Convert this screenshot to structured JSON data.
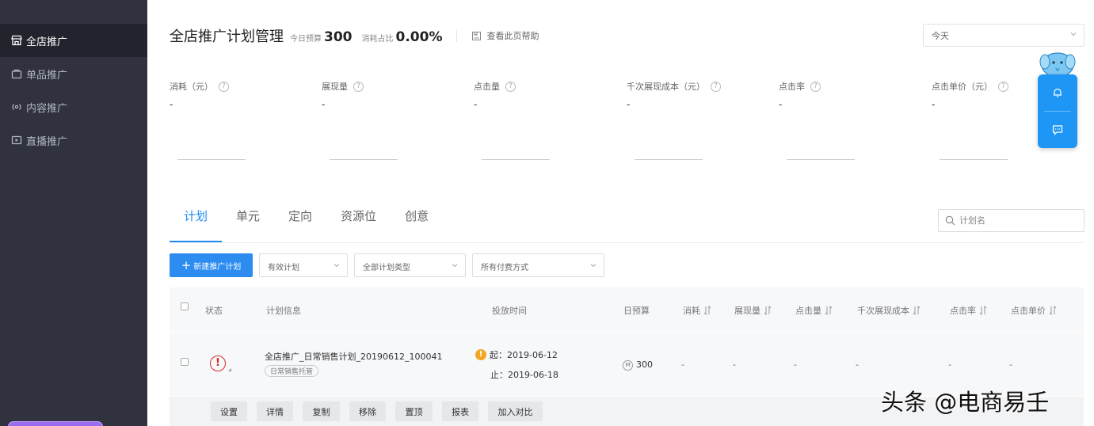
{
  "sidebar": {
    "items": [
      {
        "label": "全店推广",
        "icon": "store-icon"
      },
      {
        "label": "单品推广",
        "icon": "bag-icon"
      },
      {
        "label": "内容推广",
        "icon": "broadcast-icon"
      },
      {
        "label": "直播推广",
        "icon": "live-icon"
      }
    ]
  },
  "header": {
    "title": "全店推广计划管理",
    "budget_label": "今日预算",
    "budget_value": "300",
    "ratio_label": "消耗占比",
    "ratio_value": "0.00%",
    "help_label": "查看此页帮助"
  },
  "date_select": {
    "value": "今天"
  },
  "metrics": [
    {
      "label": "消耗（元）",
      "value": "-"
    },
    {
      "label": "展现量",
      "value": "-"
    },
    {
      "label": "点击量",
      "value": "-"
    },
    {
      "label": "千次展现成本（元）",
      "value": "-"
    },
    {
      "label": "点击率",
      "value": "-"
    },
    {
      "label": "点击单价（元）",
      "value": "-"
    }
  ],
  "tabs": [
    "计划",
    "单元",
    "定向",
    "资源位",
    "创意"
  ],
  "search": {
    "placeholder": "计划名"
  },
  "toolbar": {
    "new_label": "新建推广计划",
    "filters": [
      "有效计划",
      "全部计划类型",
      "所有付费方式"
    ]
  },
  "table": {
    "columns": {
      "status": "状态",
      "info": "计划信息",
      "time": "投放时间",
      "budget": "日预算",
      "cost": "消耗",
      "impressions": "展现量",
      "clicks": "点击量",
      "cpm": "千次展现成本",
      "ctr": "点击率",
      "cpc": "点击单价"
    },
    "rows": [
      {
        "name": "全店推广_日常销售计划_20190612_100041",
        "tag": "日常销售托管",
        "start": "起：2019-06-12",
        "end": "止：2019-06-18",
        "budget": "300",
        "cost": "-",
        "impressions": "-",
        "clicks": "-",
        "cpm": "-",
        "ctr": "-",
        "cpc": "-"
      }
    ],
    "actions": [
      "设置",
      "详情",
      "复制",
      "移除",
      "置顶",
      "报表",
      "加入对比"
    ]
  },
  "watermark": "头条 @电商易壬",
  "colors": {
    "sidebar": "#30333f",
    "accent": "#2d8cf0",
    "warning": "#f5a623",
    "error": "#d82a2a"
  }
}
